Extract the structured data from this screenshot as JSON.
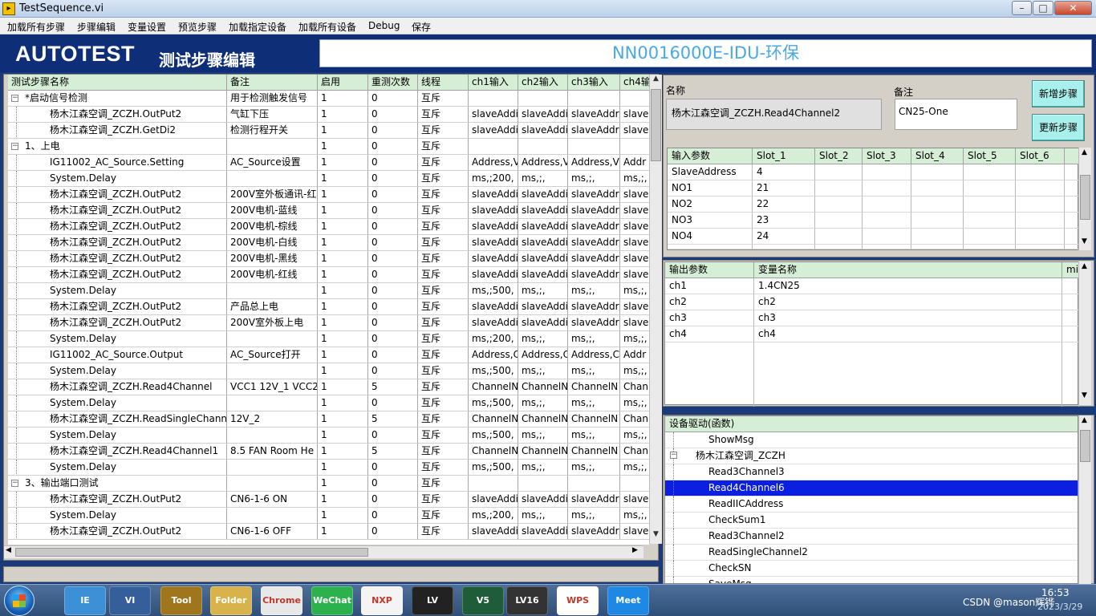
{
  "window": {
    "title": "TestSequence.vi",
    "icon_text": "▸"
  },
  "menu": [
    "加载所有步骤",
    "步骤编辑",
    "变量设置",
    "预览步骤",
    "加载指定设备",
    "加载所有设备",
    "Debug",
    "保存"
  ],
  "header": {
    "logo": "AUTOTEST",
    "heading": "测试步骤编辑",
    "sequence_name": "NN0016000E-IDU-环保"
  },
  "steps": {
    "columns": [
      "测试步骤名称",
      "备注",
      "启用",
      "重测次数",
      "线程",
      "ch1输入",
      "ch2输入",
      "ch3输入",
      "ch4输"
    ],
    "rows": [
      {
        "name": "*启动信号检测",
        "group": true,
        "note": "用于检测触发信号",
        "en": "1",
        "retry": "0",
        "thread": "互斥",
        "c1": "",
        "c2": "",
        "c3": "",
        "c4": ""
      },
      {
        "name": "杨木江森空调_ZCZH.OutPut2",
        "note": "气缸下压",
        "en": "1",
        "retry": "0",
        "thread": "互斥",
        "c1": "slaveAddi",
        "c2": "slaveAddi",
        "c3": "slaveAddr",
        "c4": "slave"
      },
      {
        "name": "杨木江森空调_ZCZH.GetDi2",
        "note": "检测行程开关",
        "en": "1",
        "retry": "0",
        "thread": "互斥",
        "c1": "slaveAddi",
        "c2": "slaveAddi",
        "c3": "slaveAddr",
        "c4": "slave"
      },
      {
        "name": "1、上电",
        "group": true,
        "note": "",
        "en": "1",
        "retry": "0",
        "thread": "互斥",
        "c1": "",
        "c2": "",
        "c3": "",
        "c4": ""
      },
      {
        "name": "IG11002_AC_Source.Setting",
        "note": "AC_Source设置",
        "en": "1",
        "retry": "0",
        "thread": "互斥",
        "c1": "Address,V",
        "c2": "Address,V",
        "c3": "Address,V",
        "c4": "Addr"
      },
      {
        "name": "System.Delay",
        "note": "",
        "en": "1",
        "retry": "0",
        "thread": "互斥",
        "c1": "ms,;200,",
        "c2": "ms,;,",
        "c3": "ms,;,",
        "c4": "ms,;,"
      },
      {
        "name": "杨木江森空调_ZCZH.OutPut2",
        "note": "200V室外板通讯-红",
        "en": "1",
        "retry": "0",
        "thread": "互斥",
        "c1": "slaveAddi",
        "c2": "slaveAddi",
        "c3": "slaveAddr",
        "c4": "slave"
      },
      {
        "name": "杨木江森空调_ZCZH.OutPut2",
        "note": "200V电机-蓝线",
        "en": "1",
        "retry": "0",
        "thread": "互斥",
        "c1": "slaveAddi",
        "c2": "slaveAddi",
        "c3": "slaveAddr",
        "c4": "slave"
      },
      {
        "name": "杨木江森空调_ZCZH.OutPut2",
        "note": "200V电机-棕线",
        "en": "1",
        "retry": "0",
        "thread": "互斥",
        "c1": "slaveAddi",
        "c2": "slaveAddi",
        "c3": "slaveAddr",
        "c4": "slave"
      },
      {
        "name": "杨木江森空调_ZCZH.OutPut2",
        "note": "200V电机-白线",
        "en": "1",
        "retry": "0",
        "thread": "互斥",
        "c1": "slaveAddi",
        "c2": "slaveAddi",
        "c3": "slaveAddr",
        "c4": "slave"
      },
      {
        "name": "杨木江森空调_ZCZH.OutPut2",
        "note": "200V电机-黑线",
        "en": "1",
        "retry": "0",
        "thread": "互斥",
        "c1": "slaveAddi",
        "c2": "slaveAddi",
        "c3": "slaveAddr",
        "c4": "slave"
      },
      {
        "name": "杨木江森空调_ZCZH.OutPut2",
        "note": "200V电机-红线",
        "en": "1",
        "retry": "0",
        "thread": "互斥",
        "c1": "slaveAddi",
        "c2": "slaveAddi",
        "c3": "slaveAddr",
        "c4": "slave"
      },
      {
        "name": "System.Delay",
        "note": "",
        "en": "1",
        "retry": "0",
        "thread": "互斥",
        "c1": "ms,;500,",
        "c2": "ms,;,",
        "c3": "ms,;,",
        "c4": "ms,;,"
      },
      {
        "name": "杨木江森空调_ZCZH.OutPut2",
        "note": "产品总上电",
        "en": "1",
        "retry": "0",
        "thread": "互斥",
        "c1": "slaveAddi",
        "c2": "slaveAddi",
        "c3": "slaveAddr",
        "c4": "slave"
      },
      {
        "name": "杨木江森空调_ZCZH.OutPut2",
        "note": "200V室外板上电",
        "en": "1",
        "retry": "0",
        "thread": "互斥",
        "c1": "slaveAddi",
        "c2": "slaveAddi",
        "c3": "slaveAddr",
        "c4": "slave"
      },
      {
        "name": "System.Delay",
        "note": "",
        "en": "1",
        "retry": "0",
        "thread": "互斥",
        "c1": "ms,;200,",
        "c2": "ms,;,",
        "c3": "ms,;,",
        "c4": "ms,;,"
      },
      {
        "name": "IG11002_AC_Source.Output",
        "note": "AC_Source打开",
        "en": "1",
        "retry": "0",
        "thread": "互斥",
        "c1": "Address,C",
        "c2": "Address,C",
        "c3": "Address,C",
        "c4": "Addr"
      },
      {
        "name": "System.Delay",
        "note": "",
        "en": "1",
        "retry": "0",
        "thread": "互斥",
        "c1": "ms,;500,",
        "c2": "ms,;,",
        "c3": "ms,;,",
        "c4": "ms,;,"
      },
      {
        "name": "杨木江森空调_ZCZH.Read4Channel",
        "note": "VCC1 12V_1 VCC2",
        "en": "1",
        "retry": "5",
        "thread": "互斥",
        "c1": "ChannelN",
        "c2": "ChannelN",
        "c3": "ChannelN",
        "c4": "Chan"
      },
      {
        "name": "System.Delay",
        "note": "",
        "en": "1",
        "retry": "0",
        "thread": "互斥",
        "c1": "ms,;500,",
        "c2": "ms,;,",
        "c3": "ms,;,",
        "c4": "ms,;,"
      },
      {
        "name": "杨木江森空调_ZCZH.ReadSingleChanne",
        "note": "12V_2",
        "en": "1",
        "retry": "5",
        "thread": "互斥",
        "c1": "ChannelN",
        "c2": "ChannelN",
        "c3": "ChannelN",
        "c4": "Chan"
      },
      {
        "name": "System.Delay",
        "note": "",
        "en": "1",
        "retry": "0",
        "thread": "互斥",
        "c1": "ms,;500,",
        "c2": "ms,;,",
        "c3": "ms,;,",
        "c4": "ms,;,"
      },
      {
        "name": "杨木江森空调_ZCZH.Read4Channel1",
        "note": "8.5 FAN Room He",
        "en": "1",
        "retry": "5",
        "thread": "互斥",
        "c1": "ChannelN",
        "c2": "ChannelN",
        "c3": "ChannelN",
        "c4": "Chan"
      },
      {
        "name": "System.Delay",
        "note": "",
        "en": "1",
        "retry": "0",
        "thread": "互斥",
        "c1": "ms,;500,",
        "c2": "ms,;,",
        "c3": "ms,;,",
        "c4": "ms,;,"
      },
      {
        "name": "3、输出端口测试",
        "group": true,
        "note": "",
        "en": "1",
        "retry": "0",
        "thread": "互斥",
        "c1": "",
        "c2": "",
        "c3": "",
        "c4": ""
      },
      {
        "name": "杨木江森空调_ZCZH.OutPut2",
        "note": "CN6-1-6 ON",
        "en": "1",
        "retry": "0",
        "thread": "互斥",
        "c1": "slaveAddi",
        "c2": "slaveAddi",
        "c3": "slaveAddr",
        "c4": "slave"
      },
      {
        "name": "System.Delay",
        "note": "",
        "en": "1",
        "retry": "0",
        "thread": "互斥",
        "c1": "ms,;200,",
        "c2": "ms,;,",
        "c3": "ms,;,",
        "c4": "ms,;,"
      },
      {
        "name": "杨木江森空调_ZCZH.OutPut2",
        "note": "CN6-1-6 OFF",
        "en": "1",
        "retry": "0",
        "thread": "互斥",
        "c1": "slaveAddi",
        "c2": "slaveAddi",
        "c3": "slaveAddr",
        "c4": "slave"
      }
    ]
  },
  "detail": {
    "name_label": "名称",
    "name_value": "杨木江森空调_ZCZH.Read4Channel2",
    "note_label": "备注",
    "note_value": "CN25-One",
    "add_button": "新增步骤",
    "update_button": "更新步骤"
  },
  "inputs": {
    "columns": [
      "输入参数",
      "Slot_1",
      "Slot_2",
      "Slot_3",
      "Slot_4",
      "Slot_5",
      "Slot_6"
    ],
    "rows": [
      [
        "SlaveAddress",
        "4"
      ],
      [
        "NO1",
        "21"
      ],
      [
        "NO2",
        "22"
      ],
      [
        "NO3",
        "23"
      ],
      [
        "NO4",
        "24"
      ]
    ]
  },
  "outputs": {
    "columns": [
      "输出参数",
      "变量名称",
      "mi"
    ],
    "rows": [
      [
        "ch1",
        "1.4CN25"
      ],
      [
        "ch2",
        "ch2"
      ],
      [
        "ch3",
        "ch3"
      ],
      [
        "ch4",
        "ch4"
      ]
    ]
  },
  "drivers": {
    "header": "设备驱动(函数)",
    "items": [
      {
        "label": "ShowMsg",
        "level": 2
      },
      {
        "label": "杨木江森空调_ZCZH",
        "level": 1,
        "expander": "⊟"
      },
      {
        "label": "Read3Channel3",
        "level": 2
      },
      {
        "label": "Read4Channel6",
        "level": 2,
        "selected": true
      },
      {
        "label": "ReadIICAddress",
        "level": 2
      },
      {
        "label": "CheckSum1",
        "level": 2
      },
      {
        "label": "Read3Channel2",
        "level": 2
      },
      {
        "label": "ReadSingleChannel2",
        "level": 2
      },
      {
        "label": "CheckSN",
        "level": 2
      },
      {
        "label": "SaveMsg",
        "level": 2
      }
    ]
  },
  "taskbar": {
    "apps": [
      "IE",
      "VI",
      "Tool",
      "Folder",
      "Chrome",
      "WeChat",
      "NXP",
      "LV",
      "V5",
      "LV16",
      "WPS",
      "Meet"
    ],
    "tray_text": "CSDN @mason辉铧",
    "time": "16:53",
    "date": "2023/3/29"
  },
  "colors": {
    "header_bg": "#0e2f78",
    "table_header": "#d6eed6",
    "button": "#a8f0ec",
    "selection": "#0a1fe0",
    "sequence_text": "#4aa8e8"
  }
}
